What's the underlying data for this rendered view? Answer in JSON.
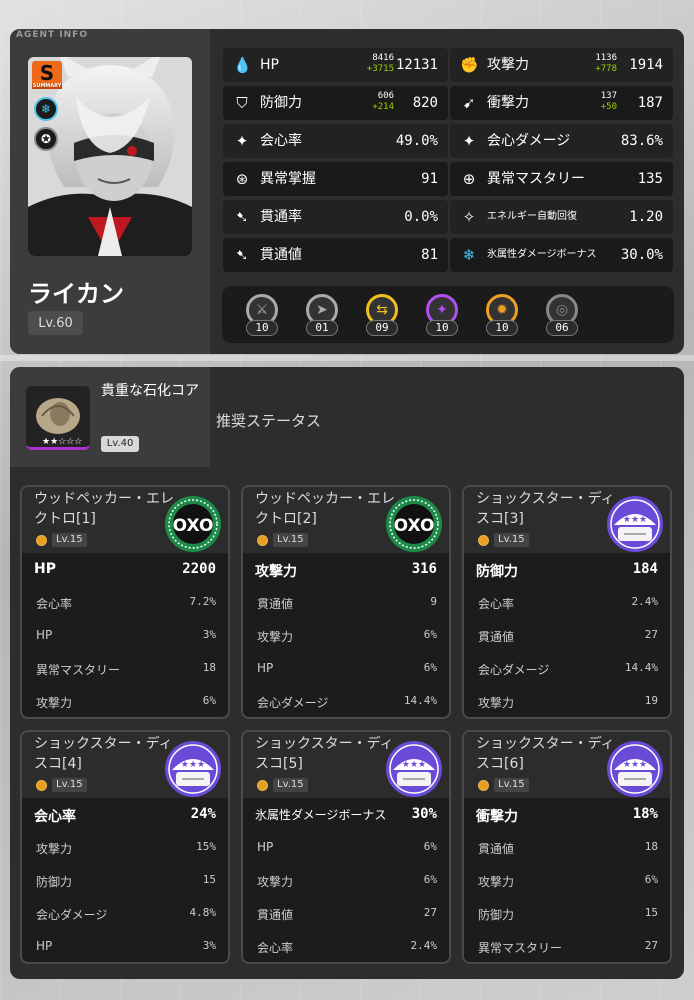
{
  "header": {
    "section_tag": "AGENT INFO"
  },
  "agent": {
    "name": "ライカン",
    "level": "Lv.60",
    "rank_badge": "S",
    "rank_caption": "SUMMARY",
    "attribute_icon": "ice-icon",
    "specialty_icon": "stun-icon"
  },
  "stats": [
    {
      "icon": "hp-icon",
      "label": "HP",
      "base": "8416",
      "plus": "+3715",
      "value": "12131"
    },
    {
      "icon": "attack-icon",
      "label": "攻撃力",
      "base": "1136",
      "plus": "+778",
      "value": "1914"
    },
    {
      "icon": "defense-icon",
      "label": "防御力",
      "base": "606",
      "plus": "+214",
      "value": "820"
    },
    {
      "icon": "impact-icon",
      "label": "衝撃力",
      "base": "137",
      "plus": "+50",
      "value": "187"
    },
    {
      "icon": "crit-rate-icon",
      "label": "会心率",
      "base": "",
      "plus": "",
      "value": "49.0%"
    },
    {
      "icon": "crit-dmg-icon",
      "label": "会心ダメージ",
      "base": "",
      "plus": "",
      "value": "83.6%"
    },
    {
      "icon": "anomaly-proficiency-icon",
      "label": "異常掌握",
      "base": "",
      "plus": "",
      "value": "91"
    },
    {
      "icon": "anomaly-mastery-icon",
      "label": "異常マスタリー",
      "base": "",
      "plus": "",
      "value": "135"
    },
    {
      "icon": "pen-ratio-icon",
      "label": "貫通率",
      "base": "",
      "plus": "",
      "value": "0.0%"
    },
    {
      "icon": "energy-regen-icon",
      "label": "エネルギー自動回復",
      "base": "",
      "plus": "",
      "value": "1.20"
    },
    {
      "icon": "pen-icon",
      "label": "貫通値",
      "base": "",
      "plus": "",
      "value": "81"
    },
    {
      "icon": "ice-dmg-icon",
      "label": "氷属性ダメージボーナス",
      "base": "",
      "plus": "",
      "value": "30.0%"
    }
  ],
  "skills": [
    {
      "icon": "basic-attack-icon",
      "level": "10",
      "color": "#aaaaaa"
    },
    {
      "icon": "dodge-icon",
      "level": "01",
      "color": "#aaaaaa"
    },
    {
      "icon": "assist-icon",
      "level": "09",
      "color": "#f0c020"
    },
    {
      "icon": "special-attack-icon",
      "level": "10",
      "color": "#b050f0"
    },
    {
      "icon": "chain-attack-icon",
      "level": "10",
      "color": "#f0a020"
    },
    {
      "icon": "core-skill-icon",
      "level": "06",
      "color": "#888888"
    }
  ],
  "wengine": {
    "name": "貴重な石化コア",
    "level": "Lv.40",
    "rec_label": "推奨ステータス",
    "rarity_color": "#b030d0"
  },
  "discs": [
    {
      "name": "ウッドペッカー・エレクトロ[1]",
      "level": "Lv.15",
      "set": "woodpecker",
      "main_label": "HP",
      "main_value": "2200",
      "subs": [
        {
          "label": "会心率",
          "value": "7.2%"
        },
        {
          "label": "HP",
          "value": "3%"
        },
        {
          "label": "異常マスタリー",
          "value": "18"
        },
        {
          "label": "攻撃力",
          "value": "6%"
        }
      ]
    },
    {
      "name": "ウッドペッカー・エレクトロ[2]",
      "level": "Lv.15",
      "set": "woodpecker",
      "main_label": "攻撃力",
      "main_value": "316",
      "subs": [
        {
          "label": "貫通値",
          "value": "9"
        },
        {
          "label": "攻撃力",
          "value": "6%"
        },
        {
          "label": "HP",
          "value": "6%"
        },
        {
          "label": "会心ダメージ",
          "value": "14.4%"
        }
      ]
    },
    {
      "name": "ショックスター・ディスコ[3]",
      "level": "Lv.15",
      "set": "shockstar",
      "main_label": "防御力",
      "main_value": "184",
      "subs": [
        {
          "label": "会心率",
          "value": "2.4%"
        },
        {
          "label": "貫通値",
          "value": "27"
        },
        {
          "label": "会心ダメージ",
          "value": "14.4%"
        },
        {
          "label": "攻撃力",
          "value": "19"
        }
      ]
    },
    {
      "name": "ショックスター・ディスコ[4]",
      "level": "Lv.15",
      "set": "shockstar",
      "main_label": "会心率",
      "main_value": "24%",
      "subs": [
        {
          "label": "攻撃力",
          "value": "15%"
        },
        {
          "label": "防御力",
          "value": "15"
        },
        {
          "label": "会心ダメージ",
          "value": "4.8%"
        },
        {
          "label": "HP",
          "value": "3%"
        }
      ]
    },
    {
      "name": "ショックスター・ディスコ[5]",
      "level": "Lv.15",
      "set": "shockstar",
      "main_label": "氷属性ダメージボーナス",
      "main_value": "30%",
      "subs": [
        {
          "label": "HP",
          "value": "6%"
        },
        {
          "label": "攻撃力",
          "value": "6%"
        },
        {
          "label": "貫通値",
          "value": "27"
        },
        {
          "label": "会心率",
          "value": "2.4%"
        }
      ]
    },
    {
      "name": "ショックスター・ディスコ[6]",
      "level": "Lv.15",
      "set": "shockstar",
      "main_label": "衝撃力",
      "main_value": "18%",
      "subs": [
        {
          "label": "貫通値",
          "value": "18"
        },
        {
          "label": "攻撃力",
          "value": "6%"
        },
        {
          "label": "防御力",
          "value": "15"
        },
        {
          "label": "異常マスタリー",
          "value": "27"
        }
      ]
    }
  ],
  "disc_logos": {
    "woodpecker": "OXO",
    "woodpecker_color": "#1e8a4a",
    "shockstar_color": "#6a4bd8"
  }
}
